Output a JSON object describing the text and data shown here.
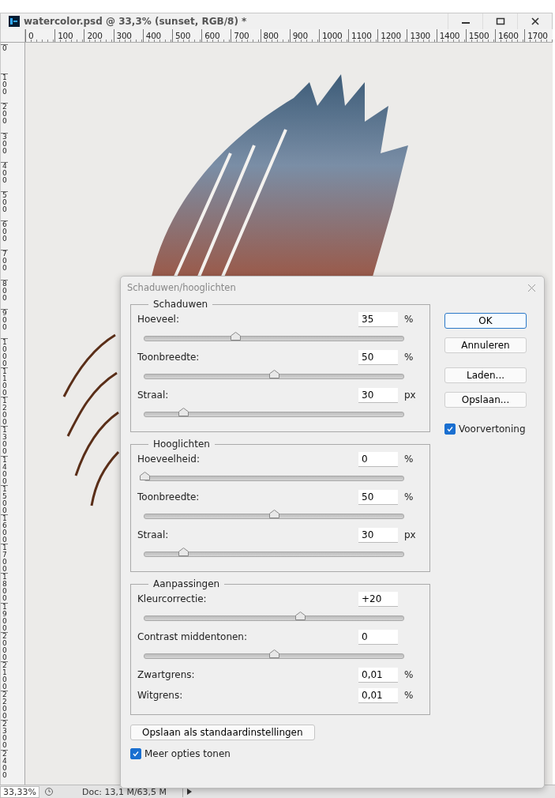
{
  "window": {
    "title": "watercolor.psd @ 33,3% (sunset, RGB/8) *"
  },
  "ruler_h": [
    "0",
    "100",
    "200",
    "300",
    "400",
    "500",
    "600",
    "700",
    "800",
    "900",
    "1000",
    "1100",
    "1200",
    "1300",
    "1400",
    "1500",
    "1600",
    "1700"
  ],
  "ruler_v": [
    "0",
    "100",
    "200",
    "300",
    "400",
    "500",
    "600",
    "700",
    "800",
    "900",
    "1000",
    "1100",
    "1200",
    "1300",
    "1400",
    "1500",
    "1600",
    "1700",
    "1800",
    "1900",
    "2000",
    "2100",
    "2200",
    "2300",
    "2400"
  ],
  "dialog": {
    "title": "Schaduwen/hooglichten",
    "groups": [
      {
        "title": "Schaduwen",
        "rows": [
          {
            "kind": "slider",
            "label": "Hoeveel:",
            "value": "35",
            "unit": "%",
            "level": 0.35
          },
          {
            "kind": "slider",
            "label": "Toonbreedte:",
            "value": "50",
            "unit": "%",
            "level": 0.5
          },
          {
            "kind": "slider",
            "label": "Straal:",
            "value": "30",
            "unit": "px",
            "level": 0.15
          }
        ]
      },
      {
        "title": "Hooglichten",
        "rows": [
          {
            "kind": "slider",
            "label": "Hoeveelheid:",
            "value": "0",
            "unit": "%",
            "level": 0
          },
          {
            "kind": "slider",
            "label": "Toonbreedte:",
            "value": "50",
            "unit": "%",
            "level": 0.5
          },
          {
            "kind": "slider",
            "label": "Straal:",
            "value": "30",
            "unit": "px",
            "level": 0.15
          }
        ]
      },
      {
        "title": "Aanpassingen",
        "rows": [
          {
            "kind": "slider",
            "label": "Kleurcorrectie:",
            "value": "+20",
            "level": 0.6
          },
          {
            "kind": "slider",
            "label": "Contrast middentonen:",
            "value": "0",
            "level": 0.5
          },
          {
            "kind": "field",
            "label": "Zwartgrens:",
            "value": "0,01",
            "unit": "%"
          },
          {
            "kind": "field",
            "label": "Witgrens:",
            "value": "0,01",
            "unit": "%"
          }
        ]
      }
    ],
    "button_groups": [
      [
        {
          "label": "OK",
          "default": true
        },
        {
          "label": "Annuleren",
          "default": false
        }
      ],
      [
        {
          "label": "Laden...",
          "default": false
        },
        {
          "label": "Opslaan...",
          "default": false
        }
      ]
    ],
    "preview": {
      "label": "Voorvertoning",
      "checked": true
    },
    "save_defaults": "Opslaan als standaardinstellingen",
    "more_options": {
      "label": "Meer opties tonen",
      "checked": true
    }
  },
  "status_bar": {
    "zoom": "33,33%",
    "doc": "Doc: 13,1 M/63,5 M"
  }
}
